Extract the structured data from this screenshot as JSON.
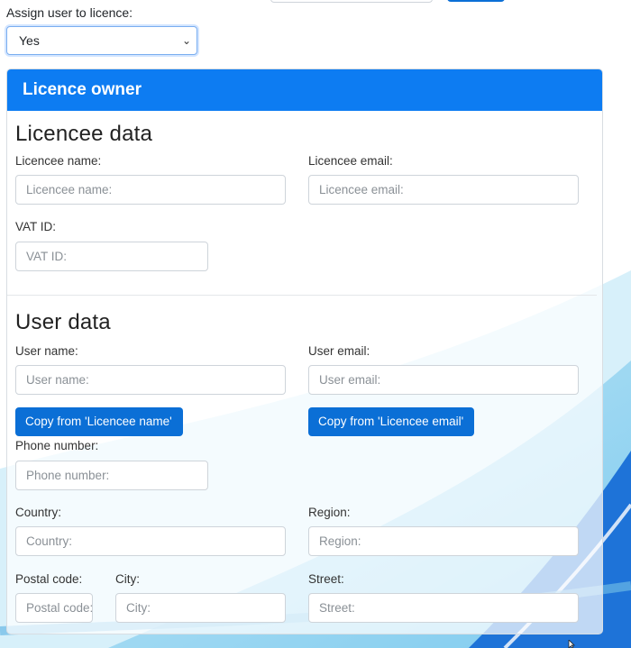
{
  "assign": {
    "label": "Assign user to licence:",
    "value": "Yes"
  },
  "card": {
    "header": "Licence owner",
    "licencee": {
      "title": "Licencee data",
      "name_label": "Licencee name:",
      "name_placeholder": "Licencee name:",
      "email_label": "Licencee email:",
      "email_placeholder": "Licencee email:",
      "vat_label": "VAT ID:",
      "vat_placeholder": "VAT ID:"
    },
    "user": {
      "title": "User data",
      "name_label": "User name:",
      "name_placeholder": "User name:",
      "email_label": "User email:",
      "email_placeholder": "User email:",
      "copy_name_button": "Copy from 'Licencee name'",
      "copy_email_button": "Copy from 'Licencee email'",
      "phone_label": "Phone number:",
      "phone_placeholder": "Phone number:",
      "country_label": "Country:",
      "country_placeholder": "Country:",
      "region_label": "Region:",
      "region_placeholder": "Region:",
      "postal_label": "Postal code:",
      "postal_placeholder": "Postal code:",
      "city_label": "City:",
      "city_placeholder": "City:",
      "street_label": "Street:",
      "street_placeholder": "Street:"
    }
  },
  "colors": {
    "accent": "#0d7cf2",
    "button": "#0b6fd6"
  },
  "icons": {
    "select_arrow": "chevron-down-icon",
    "cursor": "mouse-cursor-icon"
  }
}
